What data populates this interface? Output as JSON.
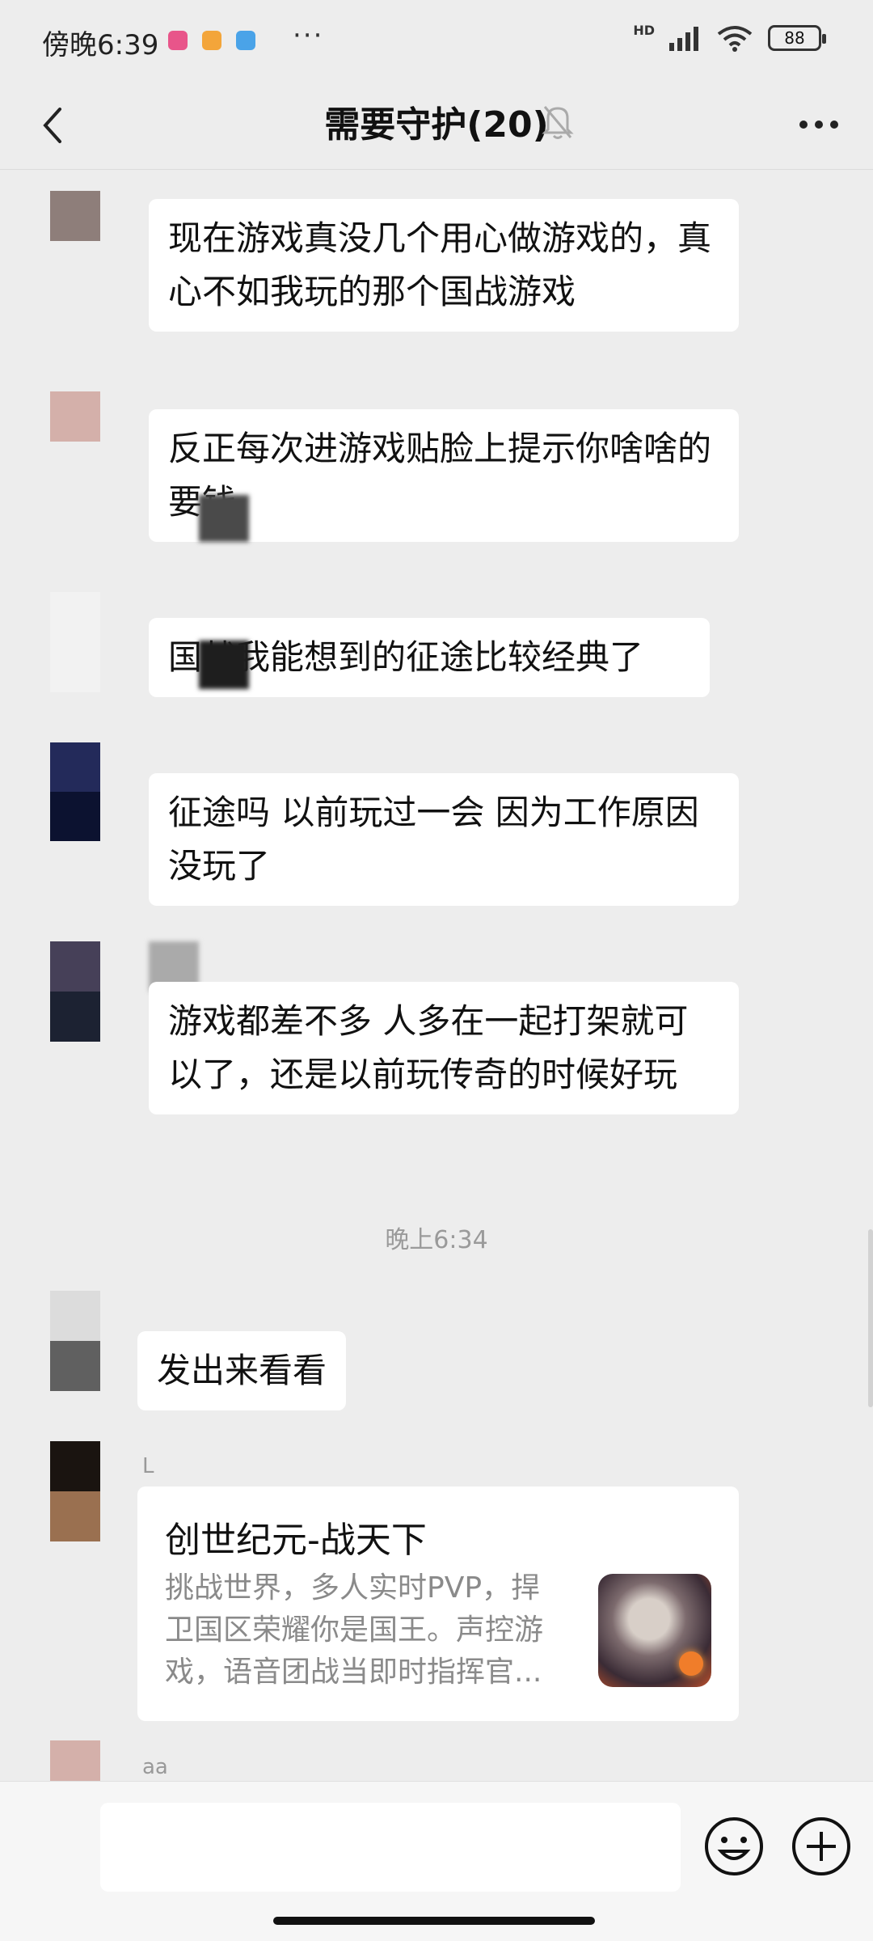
{
  "status_bar": {
    "time": "傍晚6:39",
    "more": "···",
    "network": "HD",
    "battery": "88",
    "app_icon_colors": [
      "#e8558a",
      "#f3a53a",
      "#4aa3e8"
    ]
  },
  "header": {
    "title": "需要守护(20)",
    "back_icon": "chevron-left-icon",
    "mute_icon": "bell-off-icon",
    "more_icon": "more-dots-icon"
  },
  "messages": [
    {
      "text": "现在游戏真没几个用心做游戏的，真心不如我玩的那个国战游戏",
      "avatar_color": "#8e7e7a"
    },
    {
      "text": "反正每次进游戏贴脸上提示你啥啥的要钱",
      "avatar_color": "#d4b0aa"
    },
    {
      "text": "国战我能想到的征途比较经典了",
      "avatar_color": "#f2f2f2"
    },
    {
      "text": "征途吗 以前玩过一会 因为工作原因没玩了",
      "avatar_color": "#1c2250"
    },
    {
      "text": "游戏都差不多 人多在一起打架就可以了，还是以前玩传奇的时候好玩",
      "avatar_color": "#3c3c50"
    },
    {
      "text": "发出来看看",
      "avatar_color": "#dcdcdc"
    }
  ],
  "timestamp": "晚上6:34",
  "card_message": {
    "sender": "L",
    "title": "创世纪元-战天下",
    "description": "挑战世界，多人实时PVP，捍卫国区荣耀你是国王。声控游戏，语音团战当即时指挥官...",
    "avatar_color": "#1a1410"
  },
  "last_sender": "aa",
  "input": {
    "value": "",
    "emoji_icon": "smiley-icon",
    "plus_icon": "plus-circle-icon"
  }
}
